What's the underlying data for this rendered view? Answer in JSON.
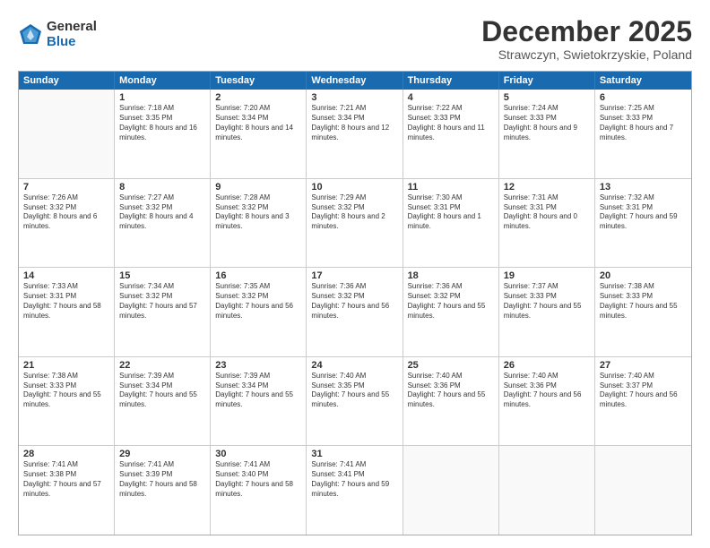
{
  "logo": {
    "general": "General",
    "blue": "Blue"
  },
  "title": "December 2025",
  "location": "Strawczyn, Swietokrzyskie, Poland",
  "days_header": [
    "Sunday",
    "Monday",
    "Tuesday",
    "Wednesday",
    "Thursday",
    "Friday",
    "Saturday"
  ],
  "weeks": [
    [
      {
        "day": "",
        "sunrise": "",
        "sunset": "",
        "daylight": ""
      },
      {
        "day": "1",
        "sunrise": "Sunrise: 7:18 AM",
        "sunset": "Sunset: 3:35 PM",
        "daylight": "Daylight: 8 hours and 16 minutes."
      },
      {
        "day": "2",
        "sunrise": "Sunrise: 7:20 AM",
        "sunset": "Sunset: 3:34 PM",
        "daylight": "Daylight: 8 hours and 14 minutes."
      },
      {
        "day": "3",
        "sunrise": "Sunrise: 7:21 AM",
        "sunset": "Sunset: 3:34 PM",
        "daylight": "Daylight: 8 hours and 12 minutes."
      },
      {
        "day": "4",
        "sunrise": "Sunrise: 7:22 AM",
        "sunset": "Sunset: 3:33 PM",
        "daylight": "Daylight: 8 hours and 11 minutes."
      },
      {
        "day": "5",
        "sunrise": "Sunrise: 7:24 AM",
        "sunset": "Sunset: 3:33 PM",
        "daylight": "Daylight: 8 hours and 9 minutes."
      },
      {
        "day": "6",
        "sunrise": "Sunrise: 7:25 AM",
        "sunset": "Sunset: 3:33 PM",
        "daylight": "Daylight: 8 hours and 7 minutes."
      }
    ],
    [
      {
        "day": "7",
        "sunrise": "Sunrise: 7:26 AM",
        "sunset": "Sunset: 3:32 PM",
        "daylight": "Daylight: 8 hours and 6 minutes."
      },
      {
        "day": "8",
        "sunrise": "Sunrise: 7:27 AM",
        "sunset": "Sunset: 3:32 PM",
        "daylight": "Daylight: 8 hours and 4 minutes."
      },
      {
        "day": "9",
        "sunrise": "Sunrise: 7:28 AM",
        "sunset": "Sunset: 3:32 PM",
        "daylight": "Daylight: 8 hours and 3 minutes."
      },
      {
        "day": "10",
        "sunrise": "Sunrise: 7:29 AM",
        "sunset": "Sunset: 3:32 PM",
        "daylight": "Daylight: 8 hours and 2 minutes."
      },
      {
        "day": "11",
        "sunrise": "Sunrise: 7:30 AM",
        "sunset": "Sunset: 3:31 PM",
        "daylight": "Daylight: 8 hours and 1 minute."
      },
      {
        "day": "12",
        "sunrise": "Sunrise: 7:31 AM",
        "sunset": "Sunset: 3:31 PM",
        "daylight": "Daylight: 8 hours and 0 minutes."
      },
      {
        "day": "13",
        "sunrise": "Sunrise: 7:32 AM",
        "sunset": "Sunset: 3:31 PM",
        "daylight": "Daylight: 7 hours and 59 minutes."
      }
    ],
    [
      {
        "day": "14",
        "sunrise": "Sunrise: 7:33 AM",
        "sunset": "Sunset: 3:31 PM",
        "daylight": "Daylight: 7 hours and 58 minutes."
      },
      {
        "day": "15",
        "sunrise": "Sunrise: 7:34 AM",
        "sunset": "Sunset: 3:32 PM",
        "daylight": "Daylight: 7 hours and 57 minutes."
      },
      {
        "day": "16",
        "sunrise": "Sunrise: 7:35 AM",
        "sunset": "Sunset: 3:32 PM",
        "daylight": "Daylight: 7 hours and 56 minutes."
      },
      {
        "day": "17",
        "sunrise": "Sunrise: 7:36 AM",
        "sunset": "Sunset: 3:32 PM",
        "daylight": "Daylight: 7 hours and 56 minutes."
      },
      {
        "day": "18",
        "sunrise": "Sunrise: 7:36 AM",
        "sunset": "Sunset: 3:32 PM",
        "daylight": "Daylight: 7 hours and 55 minutes."
      },
      {
        "day": "19",
        "sunrise": "Sunrise: 7:37 AM",
        "sunset": "Sunset: 3:33 PM",
        "daylight": "Daylight: 7 hours and 55 minutes."
      },
      {
        "day": "20",
        "sunrise": "Sunrise: 7:38 AM",
        "sunset": "Sunset: 3:33 PM",
        "daylight": "Daylight: 7 hours and 55 minutes."
      }
    ],
    [
      {
        "day": "21",
        "sunrise": "Sunrise: 7:38 AM",
        "sunset": "Sunset: 3:33 PM",
        "daylight": "Daylight: 7 hours and 55 minutes."
      },
      {
        "day": "22",
        "sunrise": "Sunrise: 7:39 AM",
        "sunset": "Sunset: 3:34 PM",
        "daylight": "Daylight: 7 hours and 55 minutes."
      },
      {
        "day": "23",
        "sunrise": "Sunrise: 7:39 AM",
        "sunset": "Sunset: 3:34 PM",
        "daylight": "Daylight: 7 hours and 55 minutes."
      },
      {
        "day": "24",
        "sunrise": "Sunrise: 7:40 AM",
        "sunset": "Sunset: 3:35 PM",
        "daylight": "Daylight: 7 hours and 55 minutes."
      },
      {
        "day": "25",
        "sunrise": "Sunrise: 7:40 AM",
        "sunset": "Sunset: 3:36 PM",
        "daylight": "Daylight: 7 hours and 55 minutes."
      },
      {
        "day": "26",
        "sunrise": "Sunrise: 7:40 AM",
        "sunset": "Sunset: 3:36 PM",
        "daylight": "Daylight: 7 hours and 56 minutes."
      },
      {
        "day": "27",
        "sunrise": "Sunrise: 7:40 AM",
        "sunset": "Sunset: 3:37 PM",
        "daylight": "Daylight: 7 hours and 56 minutes."
      }
    ],
    [
      {
        "day": "28",
        "sunrise": "Sunrise: 7:41 AM",
        "sunset": "Sunset: 3:38 PM",
        "daylight": "Daylight: 7 hours and 57 minutes."
      },
      {
        "day": "29",
        "sunrise": "Sunrise: 7:41 AM",
        "sunset": "Sunset: 3:39 PM",
        "daylight": "Daylight: 7 hours and 58 minutes."
      },
      {
        "day": "30",
        "sunrise": "Sunrise: 7:41 AM",
        "sunset": "Sunset: 3:40 PM",
        "daylight": "Daylight: 7 hours and 58 minutes."
      },
      {
        "day": "31",
        "sunrise": "Sunrise: 7:41 AM",
        "sunset": "Sunset: 3:41 PM",
        "daylight": "Daylight: 7 hours and 59 minutes."
      },
      {
        "day": "",
        "sunrise": "",
        "sunset": "",
        "daylight": ""
      },
      {
        "day": "",
        "sunrise": "",
        "sunset": "",
        "daylight": ""
      },
      {
        "day": "",
        "sunrise": "",
        "sunset": "",
        "daylight": ""
      }
    ]
  ]
}
